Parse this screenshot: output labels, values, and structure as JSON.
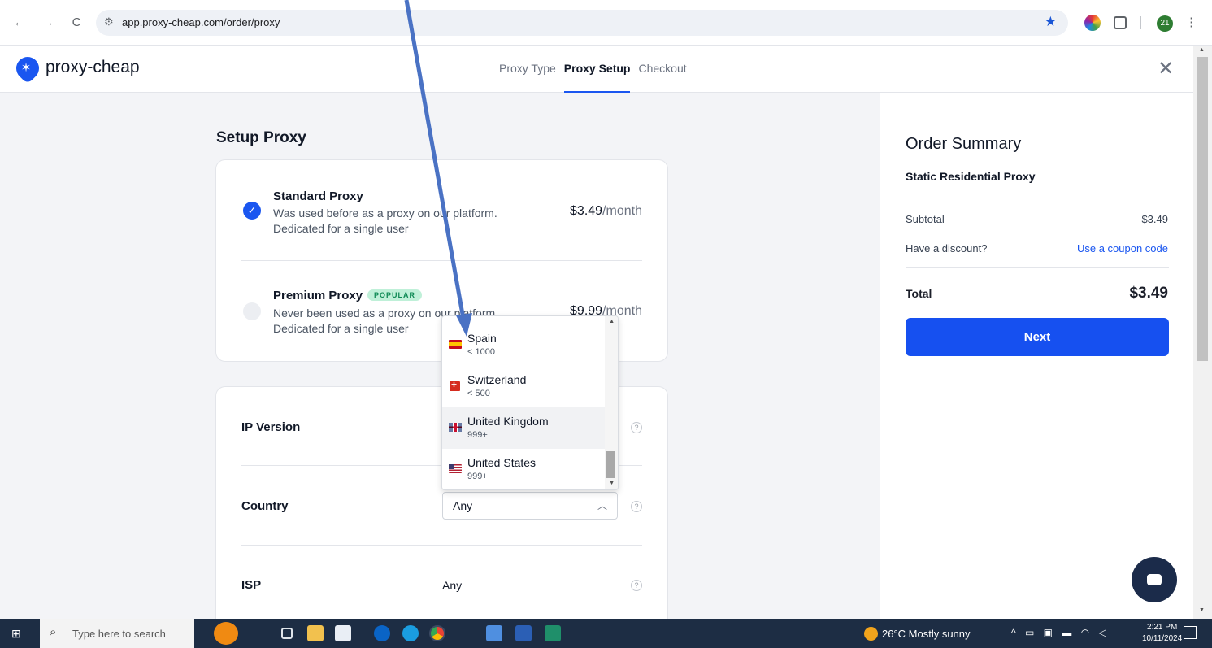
{
  "browser": {
    "back": "←",
    "forward": "→",
    "reload": "C",
    "url": "app.proxy-cheap.com/order/proxy",
    "profile_count": "21"
  },
  "header": {
    "logo": "proxy-cheap",
    "steps": [
      "Proxy Type",
      "Proxy Setup",
      "Checkout"
    ],
    "active_step": "Proxy Setup",
    "close": "✕"
  },
  "setup": {
    "title": "Setup Proxy",
    "plans": [
      {
        "name": "Standard Proxy",
        "desc1": "Was used before as a proxy on our platform.",
        "desc2": "Dedicated for a single user",
        "price": "$3.49",
        "unit": "/month",
        "selected": true
      },
      {
        "name": "Premium Proxy",
        "badge": "POPULAR",
        "desc1": "Never been used as a proxy on our platform.",
        "desc2": "Dedicated for a single user",
        "price": "$9.99",
        "unit": "/month",
        "selected": false
      }
    ],
    "settings": {
      "ip_version": "IP Version",
      "country": "Country",
      "country_value": "Any",
      "isp": "ISP",
      "isp_value": "Any",
      "help": "?"
    }
  },
  "dropdown": {
    "items": [
      {
        "name": "Spain",
        "count": "< 1000",
        "flag": "spain-flag-icon"
      },
      {
        "name": "Switzerland",
        "count": "< 500",
        "flag": "switzerland-flag-icon"
      },
      {
        "name": "United Kingdom",
        "count": "999+",
        "flag": "uk-flag-icon"
      },
      {
        "name": "United States",
        "count": "999+",
        "flag": "us-flag-icon"
      }
    ],
    "hovered": "United Kingdom"
  },
  "summary": {
    "title": "Order Summary",
    "product": "Static Residential Proxy",
    "subtotal_label": "Subtotal",
    "subtotal_value": "$3.49",
    "discount_label": "Have a discount?",
    "discount_link": "Use a coupon code",
    "total_label": "Total",
    "total_value": "$3.49",
    "next": "Next"
  },
  "taskbar": {
    "search_placeholder": "Type here to search",
    "weather": "26°C  Mostly sunny",
    "time": "2:21 PM",
    "date": "10/11/2024"
  },
  "colors": {
    "brand_blue": "#1a56f0",
    "popular_badge": "#bff0d8",
    "taskbar": "#1d2d44",
    "annotation_arrow": "#4a72c4"
  }
}
